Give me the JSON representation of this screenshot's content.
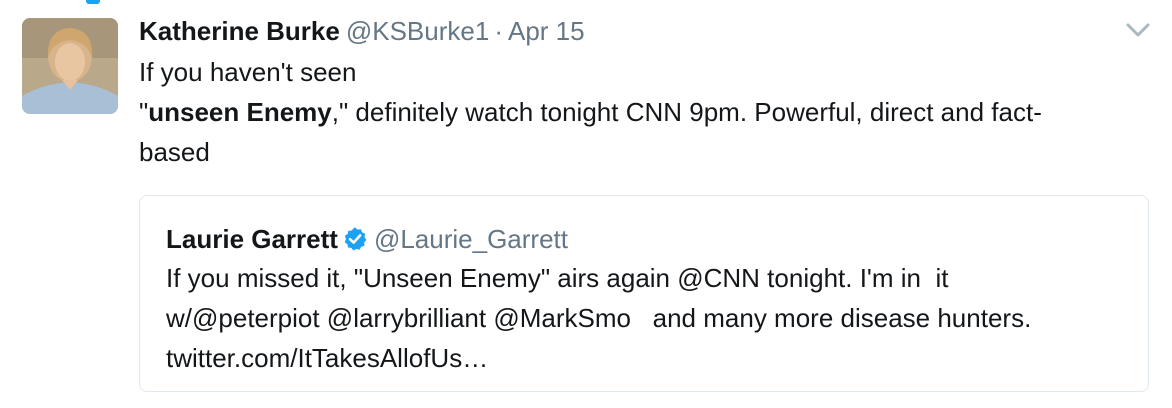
{
  "tweet": {
    "author_name": "Katherine Burke",
    "username": "@KSBurke1",
    "separator": "·",
    "date": "Apr 15",
    "text_line1": "If you haven't seen",
    "text_line2_open_quote": "\"",
    "text_line2_bold": "unseen Enemy",
    "text_line2_rest": ",\" definitely watch tonight CNN 9pm. Powerful, direct and fact-",
    "text_line3": "based",
    "avatar_icon": "profile-photo",
    "menu_icon": "chevron-down-icon"
  },
  "quoted_tweet": {
    "author_name": "Laurie Garrett",
    "verified_icon": "verified-badge-icon",
    "username": "@Laurie_Garrett",
    "line1": "If you missed it, \"Unseen Enemy\" airs again @CNN tonight. I'm in  it",
    "line2": "w/@peterpiot @larrybrilliant @MarkSmo   and many more disease hunters.",
    "line3": "twitter.com/ItTakesAllofUs…"
  },
  "colors": {
    "accent": "#1da1f2",
    "secondary_text": "#657786",
    "primary_text": "#14171a",
    "border": "#e1e8ed"
  }
}
